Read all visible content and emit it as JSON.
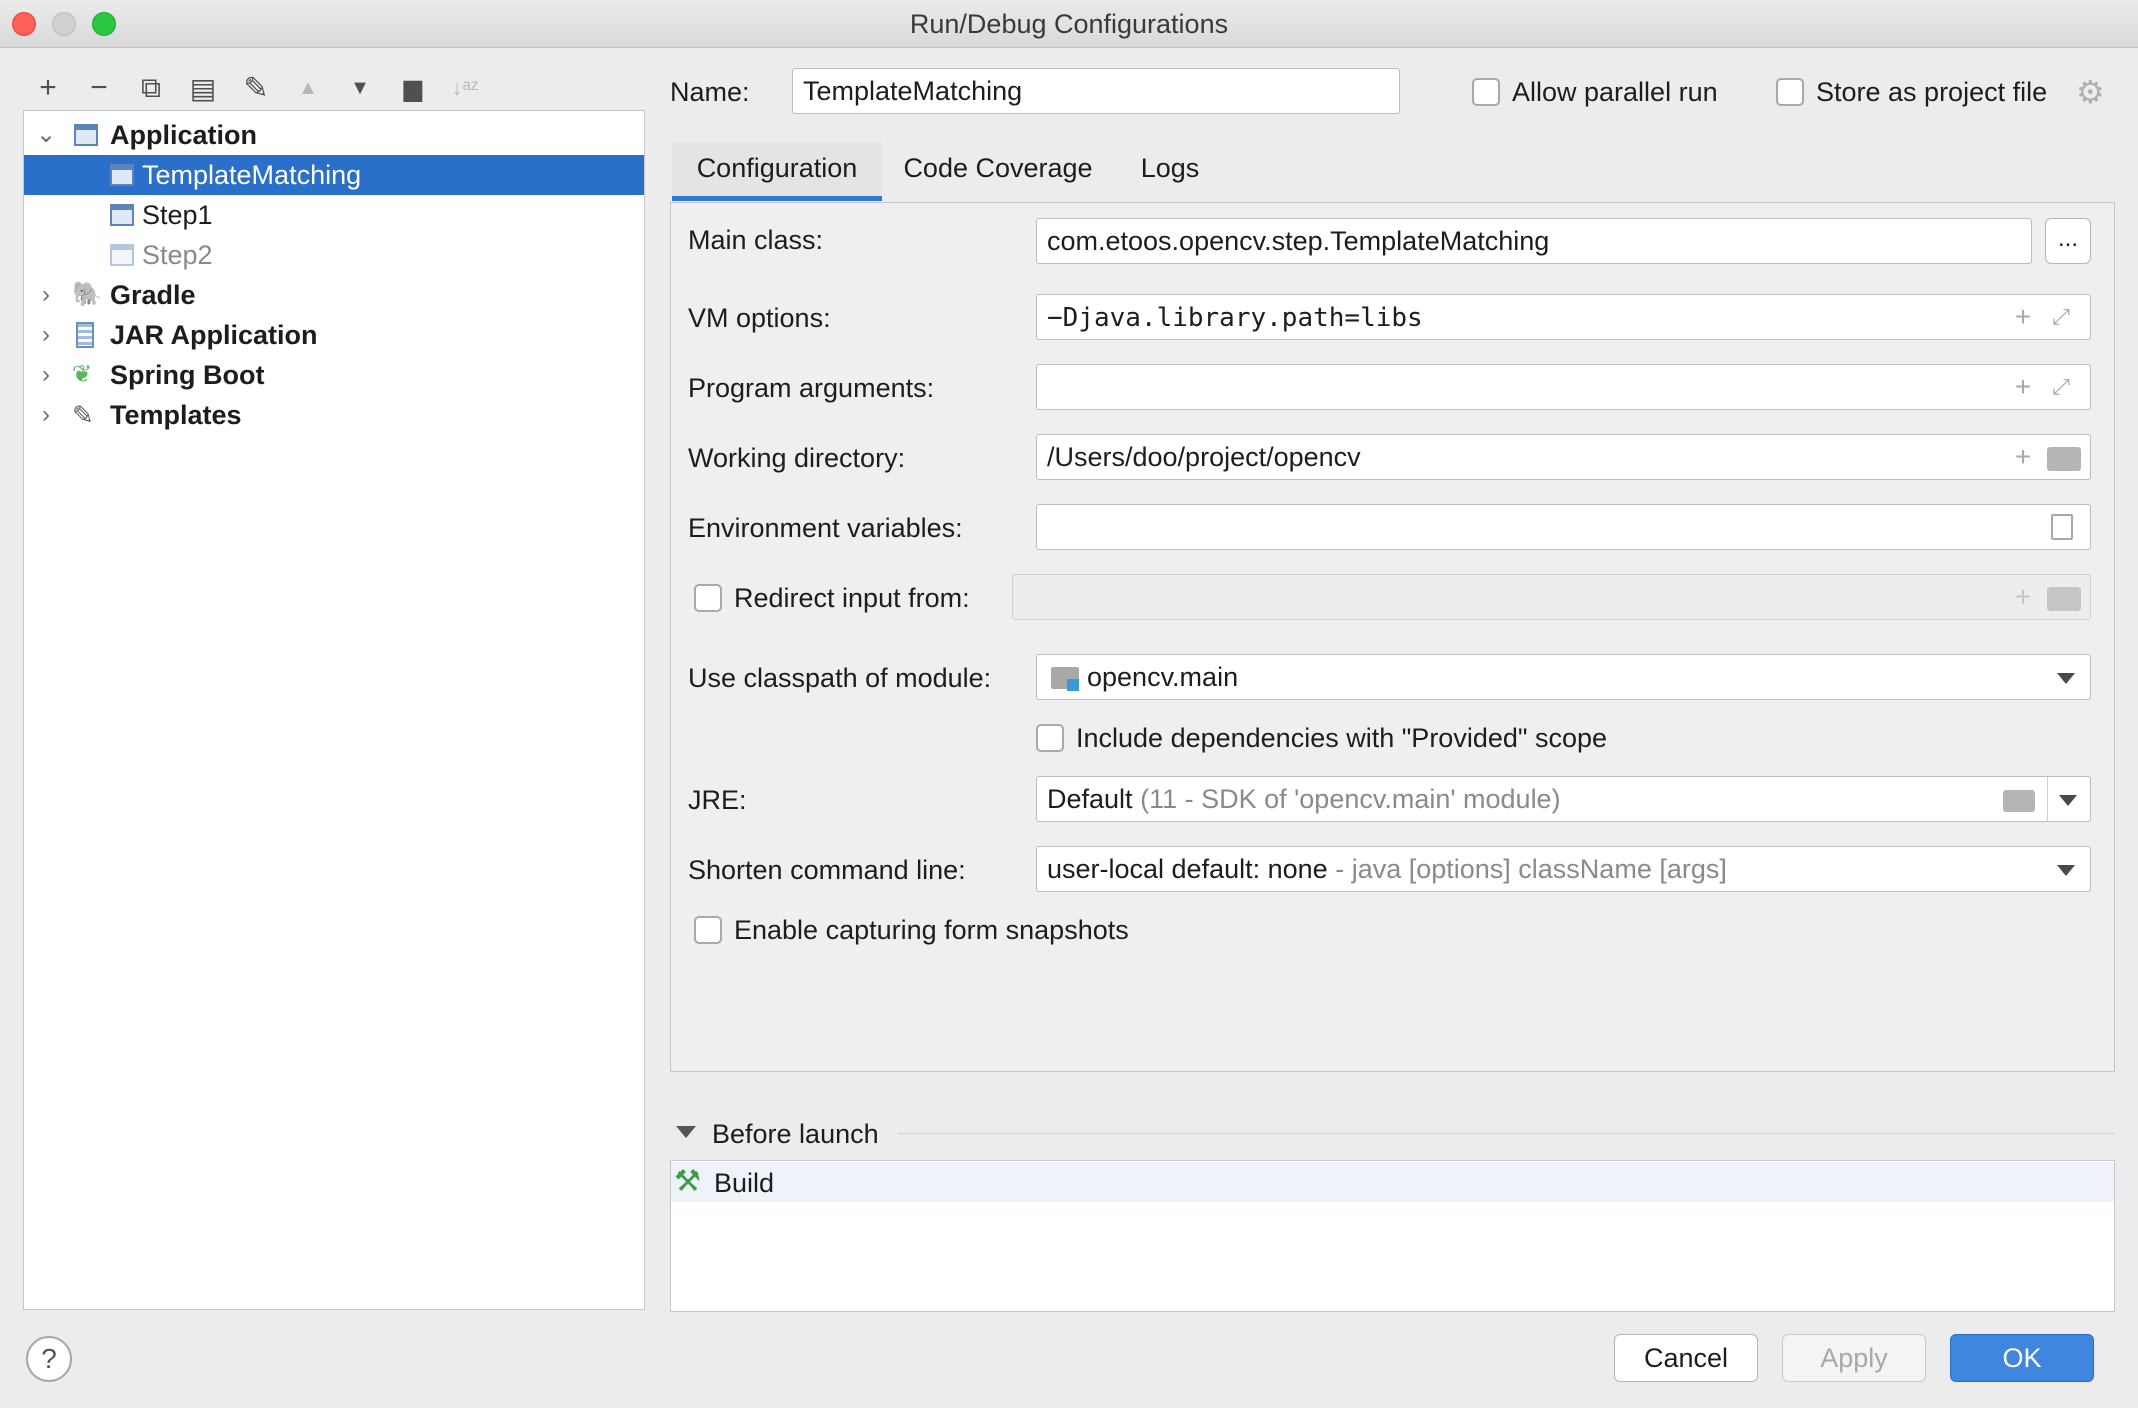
{
  "window": {
    "title": "Run/Debug Configurations"
  },
  "toolbar": {
    "add": "+",
    "remove": "−",
    "copy": "⧉",
    "save": "▤",
    "edit": "✎",
    "up": "▲",
    "down": "▼",
    "folder": "▆",
    "sort": "↓ᵃᶻ"
  },
  "tree": {
    "application": "Application",
    "template_matching": "TemplateMatching",
    "step1": "Step1",
    "step2": "Step2",
    "gradle": "Gradle",
    "jar": "JAR Application",
    "spring": "Spring Boot",
    "templates": "Templates"
  },
  "header": {
    "name_label": "Name:",
    "name_value": "TemplateMatching",
    "allow_parallel": "Allow parallel run",
    "store_project": "Store as project file"
  },
  "tabs": [
    "Configuration",
    "Code Coverage",
    "Logs"
  ],
  "config": {
    "main_class_label": "Main class:",
    "main_class_value": "com.etoos.opencv.step.TemplateMatching",
    "browse": "...",
    "vm_label": "VM options:",
    "vm_value": "−Djava.library.path=libs",
    "args_label": "Program arguments:",
    "args_value": "",
    "workdir_label": "Working directory:",
    "workdir_value": "/Users/doo/project/opencv",
    "env_label": "Environment variables:",
    "env_value": "",
    "redirect_label": "Redirect input from:",
    "classpath_label": "Use classpath of module:",
    "classpath_value": "opencv.main",
    "include_deps": "Include dependencies with \"Provided\" scope",
    "jre_label": "JRE:",
    "jre_value": "Default",
    "jre_hint": "(11 - SDK of 'opencv.main' module)",
    "shorten_label": "Shorten command line:",
    "shorten_value": "user-local default: none",
    "shorten_hint": "- java [options] className [args]",
    "snapshots": "Enable capturing form snapshots"
  },
  "before_launch": {
    "title": "Before launch",
    "items": [
      "Build"
    ]
  },
  "footer": {
    "help": "?",
    "cancel": "Cancel",
    "apply": "Apply",
    "ok": "OK"
  },
  "colors": {
    "selection": "#2a6fca",
    "accent": "#2f79d6",
    "ok_button": "#3e86de"
  }
}
